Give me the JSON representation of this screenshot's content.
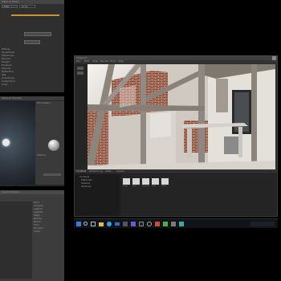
{
  "monitor1_panel": {
    "title": "Material Editor",
    "tab_a": "Map",
    "tab_b": "Node",
    "rows": [
      "Diffuse",
      "Roughness",
      "Metalness",
      "Normal",
      "Height",
      "Emission",
      "Opacity",
      "Reflection",
      "IOR",
      "Anisotropy",
      "Subsurface",
      "Coat"
    ]
  },
  "monitor2_panel": {
    "title": "Material Preview",
    "section_a": "Parameters",
    "section_b": "Texture"
  },
  "monitor3_panel": {
    "title": "Scene Explorer",
    "rows": [
      "Root",
      "Camera",
      "Light01",
      "Light02",
      "Walls",
      "Beams",
      "Bench",
      "Floor",
      "Window",
      "Shelf"
    ]
  },
  "viewport_window": {
    "title": "Viewport",
    "menu": [
      "File",
      "Edit",
      "View",
      "Render",
      "Tools",
      "Help"
    ]
  },
  "asset_browser": {
    "tabs": [
      "Content",
      "Output Log",
      "Stats",
      "Layers"
    ],
    "folders": [
      "Content",
      "Materials",
      "Meshes",
      "Textures"
    ],
    "items": [
      {
        "label": "Beam"
      },
      {
        "label": "Brick"
      },
      {
        "label": "Concrete"
      },
      {
        "label": "Floor"
      },
      {
        "label": "Glass"
      }
    ]
  },
  "taskbar": {
    "icons": [
      "start-icon",
      "search-icon",
      "task-view-icon",
      "folder-icon",
      "browser-icon",
      "mail-icon",
      "store-icon",
      "editor-icon",
      "terminal-icon",
      "settings-icon",
      "media-icon",
      "chat-icon",
      "game-icon",
      "photo-icon"
    ]
  }
}
